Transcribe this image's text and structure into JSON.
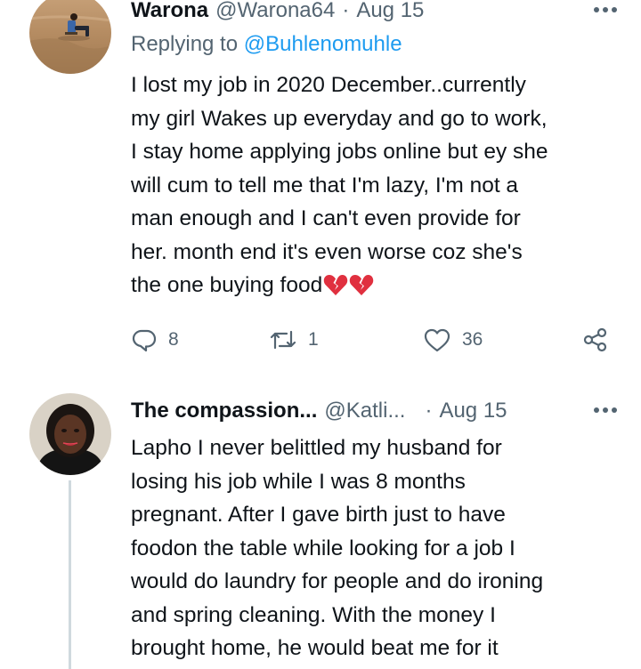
{
  "tweets": [
    {
      "display_name": "Warona",
      "handle": "@Warona64",
      "dot": "·",
      "date": "Aug 15",
      "replying_prefix": "Replying to ",
      "replying_to": "@Buhlenomuhle",
      "lines": [
        "I lost my job in 2020 December..currently",
        "my girl Wakes up everyday and go to work,",
        "I stay home applying jobs online but ey she",
        "will cum to tell me that I'm lazy, I'm not a",
        "man enough and I can't even provide for",
        "her. month end it's even worse coz she's",
        "the one buying food"
      ],
      "emoji": [
        "broken-heart",
        "broken-heart"
      ],
      "replies": "8",
      "retweets": "1",
      "likes": "36",
      "avatar_icon": "man-sitting-on-sand-avatar"
    },
    {
      "display_name": "The compassion...",
      "handle": "@Katli...",
      "dot": "·",
      "date": "Aug 15",
      "lines": [
        "Lapho I never belittled my husband for",
        "losing his job while I was 8 months",
        "pregnant. After I gave birth just to have",
        "foodon the table while looking for a job I",
        "would do laundry for people and do ironing",
        "and spring cleaning. With the money I",
        "brought home, he would beat me for it"
      ],
      "avatar_icon": "woman-portrait-avatar"
    }
  ],
  "icons": {
    "more": "more-horizontal-icon",
    "reply": "reply-bubble-icon",
    "retweet": "retweet-icon",
    "like": "heart-icon",
    "share": "share-icon"
  },
  "colors": {
    "text": "#0f1419",
    "secondary": "#536471",
    "link": "#1d9bf0",
    "divider": "#cfd9de",
    "emoji": "#e0303f"
  }
}
